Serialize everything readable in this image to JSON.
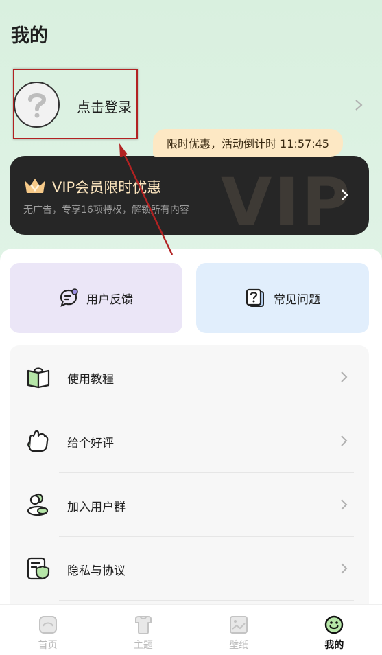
{
  "page": {
    "title": "我的"
  },
  "login": {
    "label": "点击登录",
    "avatar_icon": "question-mark-icon"
  },
  "promo": {
    "text": "限时优惠，活动倒计时 11:57:45"
  },
  "vip": {
    "title": "VIP会员限时优惠",
    "subtitle": "无广告，专享16项特权，解锁所有内容",
    "watermark": "VIP",
    "accent": "#fbe4bd"
  },
  "quick": [
    {
      "label": "用户反馈",
      "icon": "feedback-chat-icon"
    },
    {
      "label": "常见问题",
      "icon": "faq-question-icon"
    }
  ],
  "menu": [
    {
      "label": "使用教程",
      "icon": "book-icon"
    },
    {
      "label": "给个好评",
      "icon": "thumbs-up-icon"
    },
    {
      "label": "加入用户群",
      "icon": "user-group-icon"
    },
    {
      "label": "隐私与协议",
      "icon": "privacy-shield-icon"
    }
  ],
  "tabs": [
    {
      "label": "首页",
      "icon": "home-icon",
      "active": false
    },
    {
      "label": "主题",
      "icon": "theme-shirt-icon",
      "active": false
    },
    {
      "label": "壁纸",
      "icon": "wallpaper-image-icon",
      "active": false
    },
    {
      "label": "我的",
      "icon": "smiley-icon",
      "active": true
    }
  ],
  "colors": {
    "top_bg": "#dcefe2",
    "highlight": "#b22222",
    "promo_bg": "#fde8c4",
    "vip_bg": "#262626",
    "feedback_bg": "#ebe6f7",
    "faq_bg": "#e1eefc",
    "menu_bg": "#f7f7f7",
    "icon_green": "#b6e6a8"
  }
}
